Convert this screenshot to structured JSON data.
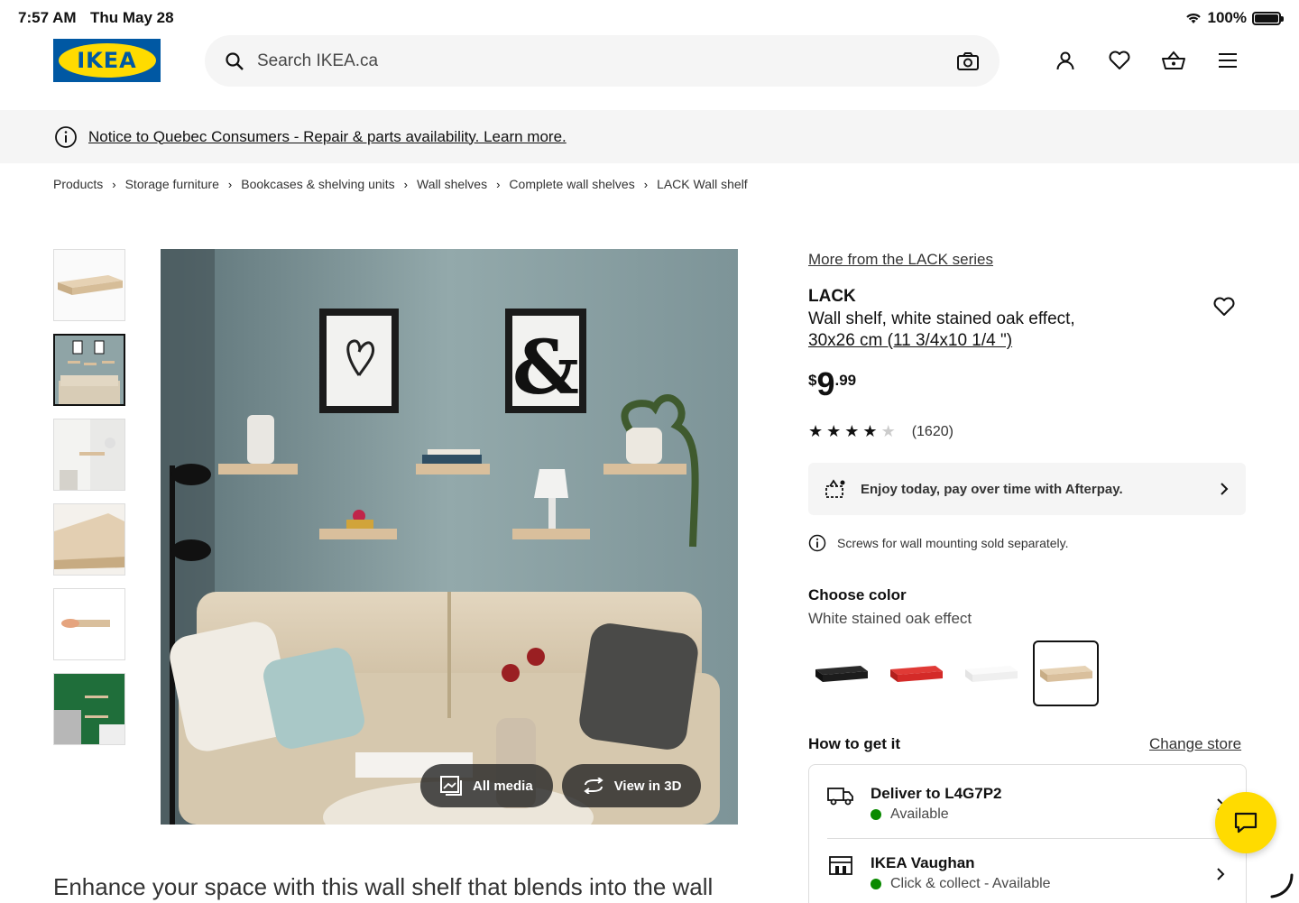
{
  "status_bar": {
    "time": "7:57 AM",
    "date": "Thu May 28",
    "battery": "100%"
  },
  "header": {
    "logo_text": "IKEA",
    "search_placeholder": "Search IKEA.ca"
  },
  "notice": {
    "text": "Notice to Quebec Consumers - Repair & parts availability. Learn more."
  },
  "breadcrumb": [
    "Products",
    "Storage furniture",
    "Bookcases & shelving units",
    "Wall shelves",
    "Complete wall shelves",
    "LACK Wall shelf"
  ],
  "media": {
    "all_media": "All media",
    "view_3d": "View in 3D"
  },
  "product": {
    "series_link": "More from the LACK series",
    "name": "LACK",
    "description": "Wall shelf, white stained oak effect,",
    "dimensions": "30x26 cm (11 3/4x10 1/4 \")",
    "price_currency": "$",
    "price_int": "9",
    "price_dec": ".99",
    "rating_stars": 4,
    "rating_count": "(1620)",
    "afterpay": "Enjoy today, pay over time with Afterpay.",
    "screws_note": "Screws for wall mounting sold separately."
  },
  "color": {
    "title": "Choose color",
    "selected": "White stained oak effect",
    "swatches": [
      "#1c1c1c",
      "#d42a28",
      "#f2f2f2",
      "#d9bf9c"
    ]
  },
  "availability": {
    "title": "How to get it",
    "change_store": "Change store",
    "delivery_title": "Deliver to L4G7P2",
    "delivery_status": "Available",
    "store_title": "IKEA Vaughan",
    "store_status": "Click & collect - Available"
  },
  "description_tagline": "Enhance your space with this wall shelf that blends into the wall",
  "colors": {
    "brand_blue": "#0058a3",
    "brand_yellow": "#ffdb00",
    "available_green": "#0a8a00"
  }
}
